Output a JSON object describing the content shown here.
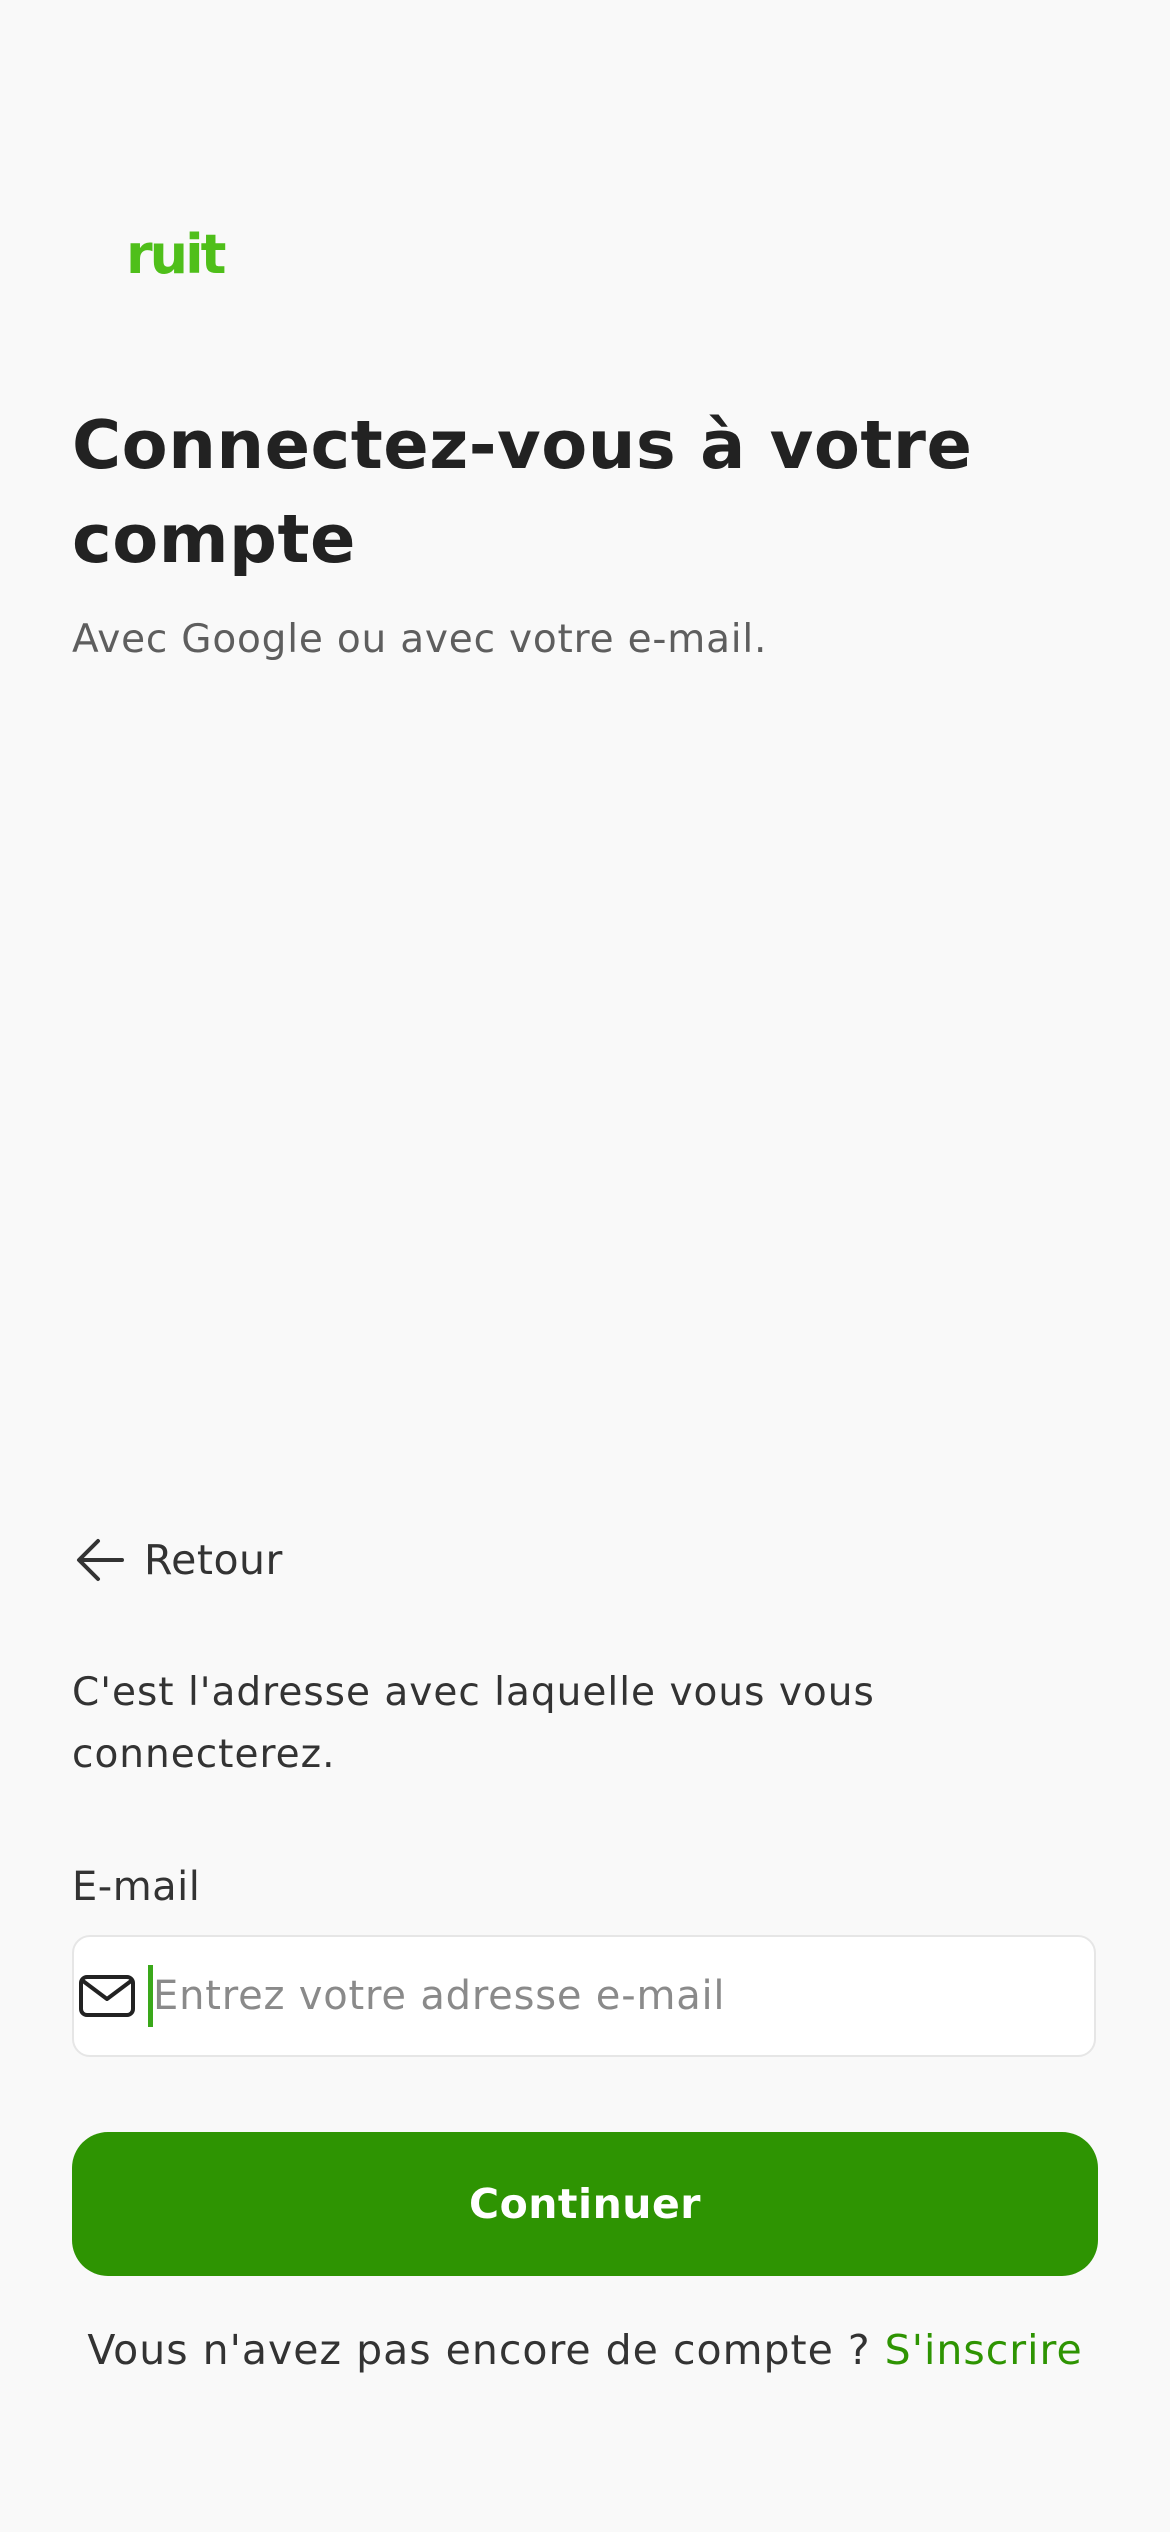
{
  "brand": {
    "logo_text": "ruit",
    "accent_color": "#4fbf1a",
    "button_color": "#2e9402"
  },
  "header": {
    "title": "Connectez-vous à votre compte",
    "subtitle": "Avec Google ou avec votre e-mail."
  },
  "nav": {
    "back_label": "Retour",
    "back_icon": "arrow-left-icon"
  },
  "form": {
    "helper_text": "C'est l'adresse avec laquelle vous vous connecterez.",
    "email_label": "E-mail",
    "email_icon": "mail-icon",
    "email_value": "",
    "email_placeholder": "Entrez votre adresse e-mail",
    "continue_label": "Continuer"
  },
  "footer": {
    "prompt": "Vous n'avez pas encore de compte ?",
    "signup_label": "S'inscrire"
  }
}
